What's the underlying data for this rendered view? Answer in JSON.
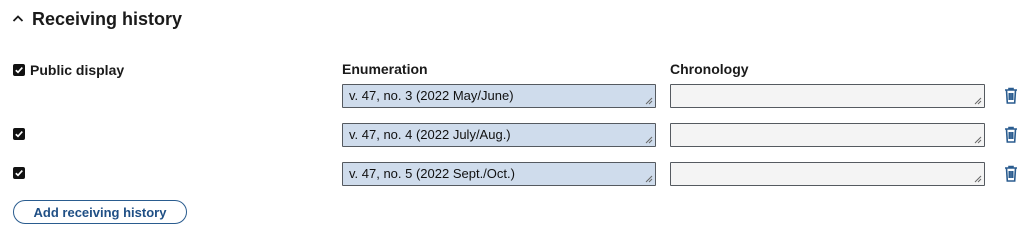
{
  "section": {
    "title": "Receiving history"
  },
  "columns": {
    "public_display": "Public display",
    "enumeration": "Enumeration",
    "chronology": "Chronology"
  },
  "rows": [
    {
      "public_display": true,
      "enumeration": "v. 47, no. 3 (2022 May/June)",
      "chronology": ""
    },
    {
      "public_display": true,
      "enumeration": "v. 47, no. 4 (2022 July/Aug.)",
      "chronology": ""
    },
    {
      "public_display": true,
      "enumeration": "v. 47, no. 5 (2022 Sept./Oct.)",
      "chronology": ""
    }
  ],
  "actions": {
    "add_label": "Add receiving history"
  },
  "icons": {
    "collapse": "chevron-up-icon",
    "delete": "trash-icon",
    "check": "checkmark-icon"
  },
  "colors": {
    "accent": "#1f4f85",
    "trash": "#2a5c8f",
    "filled_field": "#cfdcec"
  }
}
